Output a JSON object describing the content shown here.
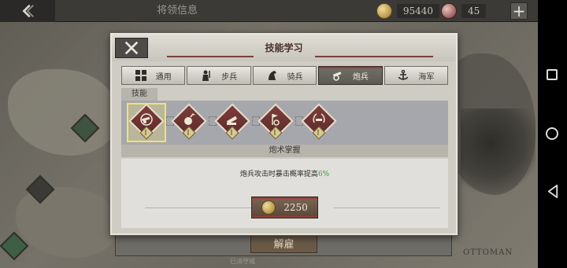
{
  "topbar": {
    "title": "将领信息",
    "gold": "95440",
    "gems": "45",
    "icons": {
      "back": "back-arrow-icon",
      "gold": "gold-coin-icon",
      "gem": "medal-icon",
      "plus": "plus-icon"
    }
  },
  "background": {
    "map_label": "OTTOMAN",
    "unlock_label": "解雇",
    "caption": "已派守城"
  },
  "modal": {
    "title": "技能学习",
    "tabs": [
      {
        "label": "通用",
        "icon": "grid-icon"
      },
      {
        "label": "步兵",
        "icon": "infantry-icon"
      },
      {
        "label": "骑兵",
        "icon": "cavalry-icon"
      },
      {
        "label": "炮兵",
        "icon": "artillery-icon",
        "active": true
      },
      {
        "label": "海军",
        "icon": "anchor-icon"
      }
    ],
    "skills_header": "技能",
    "skills": [
      {
        "icon": "cannon-emblem-icon",
        "level": "I",
        "selected": true
      },
      {
        "icon": "bomb-icon",
        "level": "I"
      },
      {
        "icon": "mortar-icon",
        "level": "I"
      },
      {
        "icon": "flag-artillery-icon",
        "level": "I"
      },
      {
        "icon": "wreath-cannon-icon",
        "level": "I"
      }
    ],
    "mastery_header": "炮术掌握",
    "description_prefix": "炮兵攻击时暴击概率提高",
    "description_value": "6%",
    "cost": "2250",
    "colors": {
      "accent": "#9b3a35",
      "highlight": "#3d9a3e",
      "selected": "#f2e36d"
    }
  }
}
